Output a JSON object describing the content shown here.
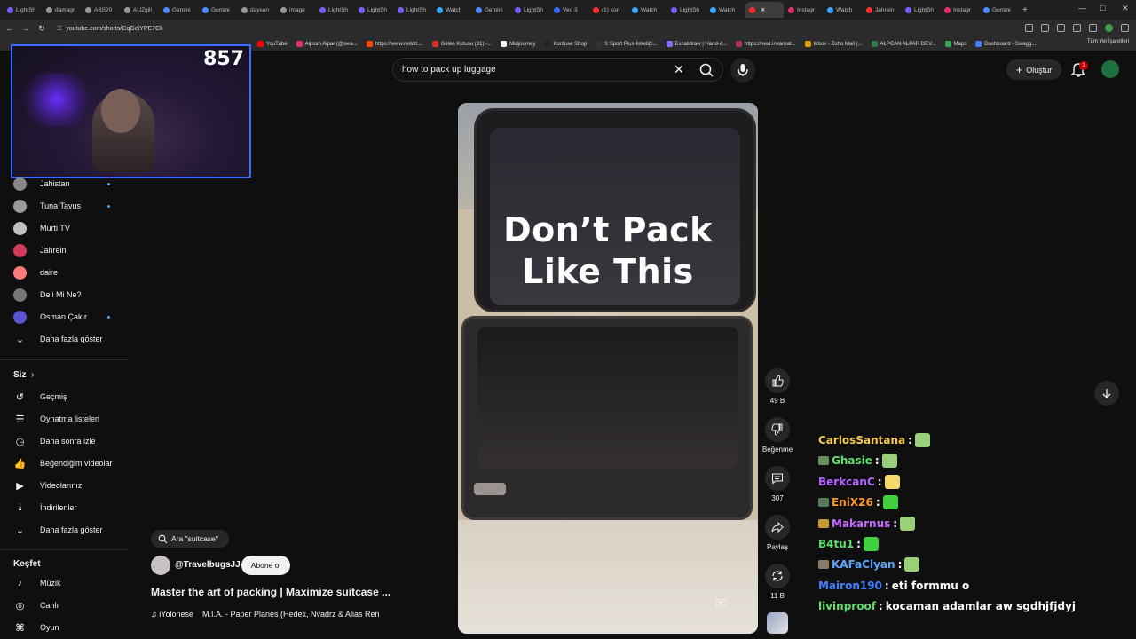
{
  "browser": {
    "tabs": [
      "LightSh",
      "damagr",
      "ABS20",
      "AUZgill",
      "Gemini",
      "Gemini",
      "daysun",
      "image",
      "LightSh",
      "LightSh",
      "LightSh",
      "Watch",
      "Gemini",
      "LightSh",
      "Veo 3",
      "(1) kon",
      "Watch",
      "LightSh",
      "Watch",
      "",
      "Instagr",
      "Watch",
      "Jahrein",
      "LightSh",
      "Instagr",
      "Gemini"
    ],
    "new_tab": "+",
    "url": "youtube.com/shorts/CqGeiYPE7Ck",
    "bookmarks": [
      "YouTube",
      "Alpcan Alpar (@swa...",
      "https://www.reddit....",
      "Gelen Kutusu (31) -...",
      "Midjourney",
      "Konfuse Shop",
      "S Sport Plus-İstediği...",
      "Excalidraw | Hand-d...",
      "https://next.inkarnat...",
      "Inbox - Zoho Mail (...",
      "ALPCAN ALPAR DEV...",
      "Maps",
      "Dashboard - Swagg..."
    ],
    "other_bookmarks": "Tüm Yer İşaretleri"
  },
  "webcam": {
    "viewer_count": "857"
  },
  "sidebar": {
    "subscriptions": [
      {
        "label": "Jahistan",
        "live": true
      },
      {
        "label": "Tuna Tavus",
        "live": true
      },
      {
        "label": "Murti TV",
        "live": false
      },
      {
        "label": "Jahrein",
        "live": false
      },
      {
        "label": "daire",
        "live": false
      },
      {
        "label": "Deli Mi Ne?",
        "live": false
      },
      {
        "label": "Osman Çakır",
        "live": true
      }
    ],
    "show_more_1": "Daha fazla göster",
    "you_header": "Siz",
    "you_items": [
      "Geçmiş",
      "Oynatma listeleri",
      "Daha sonra izle",
      "Beğendiğim videolar",
      "Videolarınız",
      "İndirilenler"
    ],
    "show_more_2": "Daha fazla göster",
    "explore_header": "Keşfet",
    "explore_items": [
      "Müzik",
      "Canlı",
      "Oyun"
    ]
  },
  "search": {
    "query": "how to pack up luggage"
  },
  "header": {
    "create_label": "Oluştur",
    "notification_count": "1"
  },
  "video": {
    "overlay_line1": "Don’t Pack",
    "overlay_line2": "Like This"
  },
  "actions": {
    "like_count": "49 B",
    "dislike_label": "Beğenme",
    "comment_count": "307",
    "share_label": "Paylaş",
    "remix_count": "11 B"
  },
  "short": {
    "search_chip": "Ara \"suitcase\"",
    "channel": "@TravelbugsJJ",
    "subscribe_label": "Abone ol",
    "title": "Master the art of packing | Maximize suitcase ...",
    "music": "iYolonese    M.I.A. - Paper Planes (Hedex, Nvadrz & Alias Ren"
  },
  "chat": [
    {
      "user": "CarlosSantana",
      "color": "#f2c94c",
      "msg": "",
      "emote": true
    },
    {
      "user": "Ghasie",
      "color": "#5fe06a",
      "msg": "",
      "emote": true,
      "badge": "#6a8f5a"
    },
    {
      "user": "BerkcanC",
      "color": "#b464ff",
      "msg": "",
      "emote": true
    },
    {
      "user": "EniX26",
      "color": "#ff9a2e",
      "msg": "",
      "emote": true,
      "badge": "#5a7a5a"
    },
    {
      "user": "Makarnus",
      "color": "#c36bff",
      "msg": "",
      "emote": true,
      "badge": "#c79a3a"
    },
    {
      "user": "B4tu1",
      "color": "#5fe06a",
      "msg": "",
      "emote": true
    },
    {
      "user": "KAFaClyan",
      "color": "#5aa7ff",
      "msg": "",
      "emote": true,
      "badge": "#8a7a6a"
    },
    {
      "user": "Mairon190",
      "color": "#3f7fff",
      "msg": "eti formmu o",
      "emote": false
    },
    {
      "user": "livinproof",
      "color": "#5fe06a",
      "msg": "kocaman adamlar aw sgdhjfjdyj",
      "emote": false
    }
  ]
}
